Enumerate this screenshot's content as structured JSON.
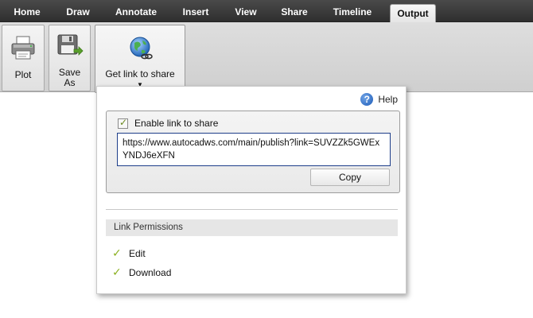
{
  "tabs": [
    {
      "label": "Home",
      "active": false
    },
    {
      "label": "Draw",
      "active": false
    },
    {
      "label": "Annotate",
      "active": false
    },
    {
      "label": "Insert",
      "active": false
    },
    {
      "label": "View",
      "active": false
    },
    {
      "label": "Share",
      "active": false
    },
    {
      "label": "Timeline",
      "active": false
    },
    {
      "label": "Output",
      "active": true
    }
  ],
  "ribbon": {
    "plot_label": "Plot",
    "save_as_line1": "Save",
    "save_as_line2": "As",
    "get_link_label": "Get link to share",
    "get_link_arrow": "▼"
  },
  "popup": {
    "help_label": "Help",
    "enable_link_label": "Enable link to share",
    "enable_link_checked": true,
    "share_url": "https://www.autocadws.com/main/publish?link=SUVZZk5GWExYNDJ6eXFN",
    "copy_label": "Copy",
    "permissions_header": "Link Permissions",
    "permissions": [
      {
        "label": "Edit",
        "granted": true
      },
      {
        "label": "Download",
        "granted": true
      }
    ]
  },
  "colors": {
    "tabbar_bg": "#3b3b3b",
    "url_border": "#1e3e8a",
    "check_green": "#8bb020",
    "help_blue": "#1e5cb8"
  }
}
